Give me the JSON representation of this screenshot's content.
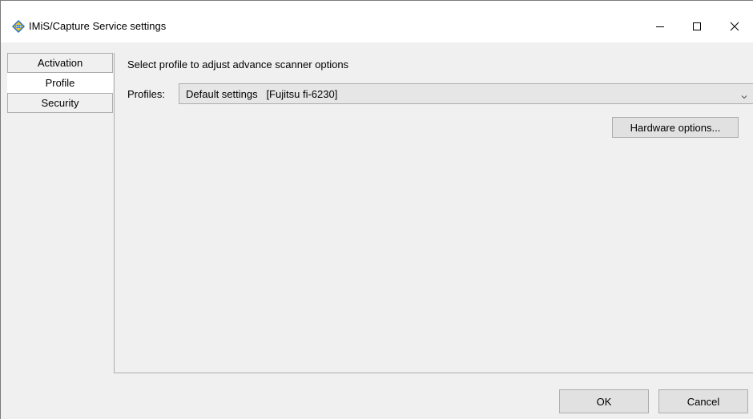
{
  "window": {
    "title": "IMiS/Capture Service settings",
    "icon": "imis-app-icon",
    "controls": {
      "minimize": "minimize-icon",
      "maximize": "maximize-icon",
      "close": "close-icon"
    }
  },
  "tabs": [
    {
      "label": "Activation",
      "active": false
    },
    {
      "label": "Profile",
      "active": true
    },
    {
      "label": "Security",
      "active": false
    }
  ],
  "profile": {
    "instruction": "Select profile to adjust advance scanner options",
    "profiles_label": "Profiles:",
    "selected_profile": "Default settings   [Fujitsu fi-6230]",
    "hardware_button": "Hardware options..."
  },
  "footer": {
    "ok_label": "OK",
    "cancel_label": "Cancel"
  },
  "colors": {
    "window_bg": "#f0f0f0",
    "titlebar_bg": "#ffffff",
    "border": "#adadad",
    "button_bg": "#e1e1e1"
  }
}
